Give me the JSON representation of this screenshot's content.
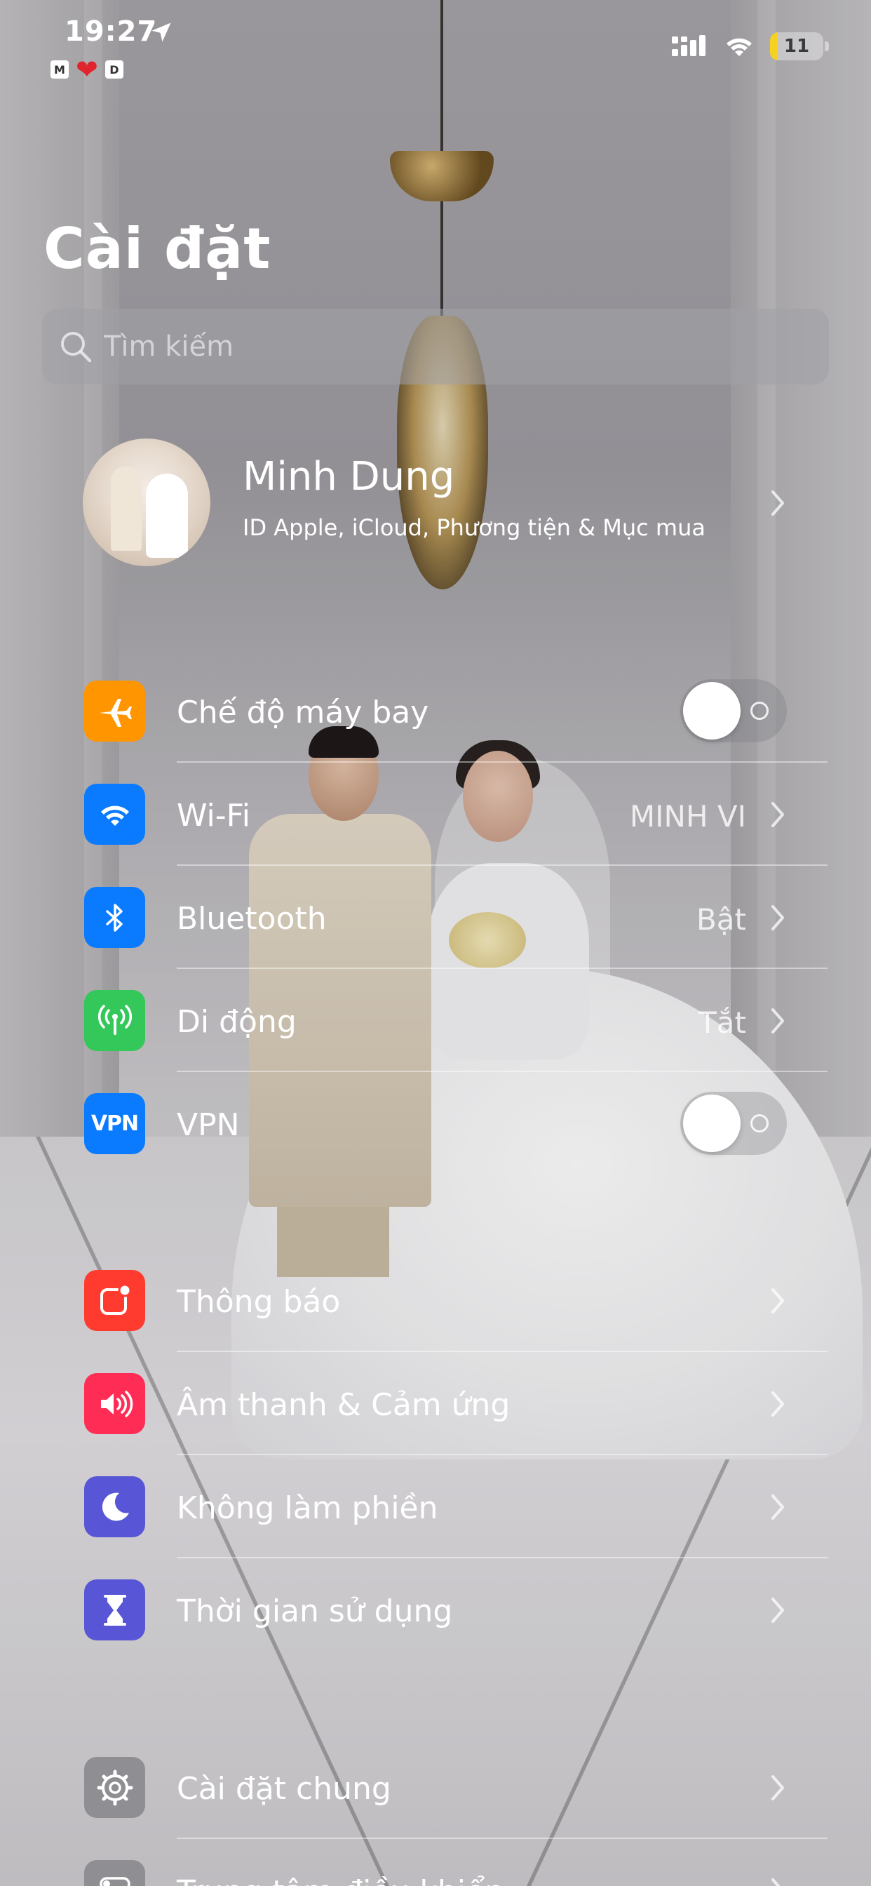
{
  "status_bar": {
    "time": "19:27",
    "mini_labels": [
      "M",
      "D"
    ],
    "battery_level": "11",
    "battery_fraction": 0.11,
    "battery_color": "#f7d11f"
  },
  "title": "Cài đặt",
  "search": {
    "placeholder": "Tìm kiếm"
  },
  "profile": {
    "name": "Minh Dung",
    "subtitle": "ID Apple, iCloud, Phương tiện & Mục mua"
  },
  "connectivity": [
    {
      "id": "airplane",
      "label": "Chế độ máy bay",
      "icon": "airplane-icon",
      "icon_bg": "#ff9500",
      "control": "toggle",
      "on": false
    },
    {
      "id": "wifi",
      "label": "Wi-Fi",
      "icon": "wifi-icon",
      "icon_bg": "#0a7aff",
      "value": "MINH VI",
      "control": "chevron"
    },
    {
      "id": "bluetooth",
      "label": "Bluetooth",
      "icon": "bluetooth-icon",
      "icon_bg": "#0a7aff",
      "value": "Bật",
      "control": "chevron"
    },
    {
      "id": "cellular",
      "label": "Di động",
      "icon": "antenna-icon",
      "icon_bg": "#34c759",
      "value": "Tắt",
      "control": "chevron"
    },
    {
      "id": "vpn",
      "label": "VPN",
      "icon": "vpn-icon",
      "icon_text": "VPN",
      "icon_bg": "#0a7aff",
      "control": "toggle",
      "on": false
    }
  ],
  "notifications_group": [
    {
      "id": "notifications",
      "label": "Thông báo",
      "icon": "notification-icon",
      "icon_bg": "#ff3b30"
    },
    {
      "id": "sounds",
      "label": "Âm thanh & Cảm ứng",
      "icon": "speaker-icon",
      "icon_bg": "#ff2d55"
    },
    {
      "id": "focus",
      "label": "Không làm phiền",
      "icon": "moon-icon",
      "icon_bg": "#5856d6"
    },
    {
      "id": "screen_time",
      "label": "Thời gian sử dụng",
      "icon": "hourglass-icon",
      "icon_bg": "#5856d6"
    }
  ],
  "general_group": [
    {
      "id": "general",
      "label": "Cài đặt chung",
      "icon": "gear-icon",
      "icon_bg": "#8e8e93"
    },
    {
      "id": "control_center",
      "label": "Trung tâm điều khiển",
      "icon": "switches-icon",
      "icon_bg": "#8e8e93"
    }
  ]
}
